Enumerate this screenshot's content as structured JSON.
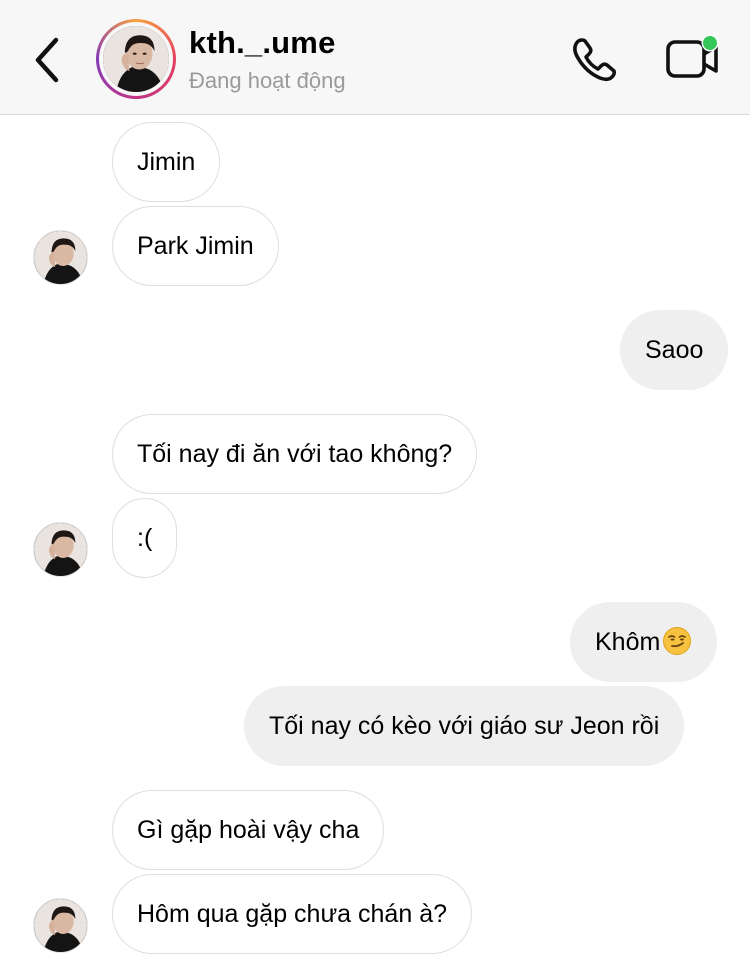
{
  "header": {
    "title": "kth._.ume",
    "status": "Đang hoạt động",
    "status_dot_color": "#35c759"
  },
  "icons": {
    "back": "chevron-left-icon",
    "call": "phone-icon",
    "video": "video-camera-icon"
  },
  "messages": [
    {
      "side": "in",
      "text": "Jimin"
    },
    {
      "side": "in",
      "text": "Park Jimin"
    },
    {
      "side": "out",
      "text": "Saoo"
    },
    {
      "side": "in",
      "text": "Tối nay đi ăn với tao không?"
    },
    {
      "side": "in",
      "text": ":("
    },
    {
      "side": "out",
      "text": "Khôm",
      "emoji": "smirking-face"
    },
    {
      "side": "out",
      "text": "Tối nay có kèo với giáo sư Jeon rồi"
    },
    {
      "side": "in",
      "text": "Gì gặp hoài vậy cha"
    },
    {
      "side": "in",
      "text": "Hôm qua gặp chưa chán à?"
    }
  ]
}
